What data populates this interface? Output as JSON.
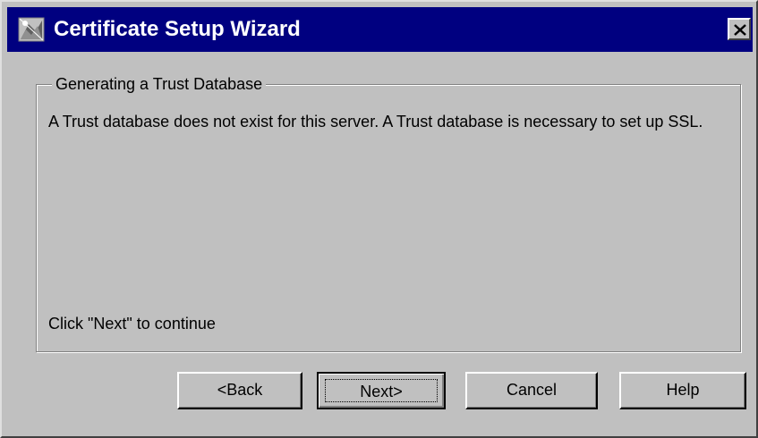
{
  "window": {
    "title": "Certificate Setup Wizard",
    "title_icon": "certificate-wizard-icon",
    "close_icon": "close-icon"
  },
  "group": {
    "title": "Generating a Trust Database",
    "description": "A Trust database does not exist for this server.  A Trust database is necessary to set up SSL.",
    "footer": "Click \"Next\" to continue"
  },
  "buttons": {
    "back": "<Back",
    "next": "Next>",
    "cancel": "Cancel",
    "help": "Help"
  },
  "colors": {
    "titlebar": "#000080",
    "face": "#c0c0c0"
  }
}
